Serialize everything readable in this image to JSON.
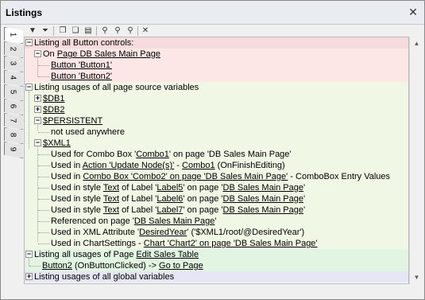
{
  "window": {
    "title": "Listings",
    "close_glyph": "✕"
  },
  "tabs": [
    "1",
    "2",
    "3",
    "4",
    "5",
    "6",
    "7",
    "8",
    "9"
  ],
  "toolbar": {
    "buttons": [
      "dropdown-icon",
      "collapse-all-icon",
      "expand-all-icon",
      "copy-icon",
      "copy-all-icon",
      "find-icon",
      "find-next-icon",
      "find-previous-icon",
      "clear-icon"
    ]
  },
  "tree": {
    "s1": {
      "header": "Listing all Button controls:",
      "page_prefix": "On ",
      "page_link": "Page DB Sales Main Page",
      "items": [
        "Button 'Button1'",
        "Button 'Button2'"
      ]
    },
    "s2": {
      "header": "Listing usages of all page source variables",
      "db1": "$DB1",
      "db2": "$DB2",
      "persistent": "$PERSISTENT",
      "not_used": "not used anywhere",
      "xml1": "$XML1",
      "x1": {
        "a": "Used for Combo Box '",
        "b": "Combo1",
        "c": "' on page '",
        "d": "DB Sales Main Page",
        "e": "'"
      },
      "x2": {
        "a": "Used in ",
        "b": "Action 'Update Node(s)'",
        "c": " - ",
        "d": "Combo1",
        "e": " (OnFinishEditing)"
      },
      "x3": {
        "a": "Used in ",
        "b": "Combo Box 'Combo2' on page 'DB Sales Main Page'",
        "c": " - ComboBox Entry Values"
      },
      "x4": {
        "a": "Used in style ",
        "b": "Text",
        "c": " of Label '",
        "d": "Label5",
        "e": "' on page '",
        "f": "DB Sales Main Page",
        "g": "'"
      },
      "x5": {
        "a": "Used in style ",
        "b": "Text",
        "c": " of Label '",
        "d": "Label6",
        "e": "' on page '",
        "f": "DB Sales Main Page",
        "g": "'"
      },
      "x6": {
        "a": "Used in style ",
        "b": "Text",
        "c": " of Label '",
        "d": "Label7",
        "e": "' on page '",
        "f": "DB Sales Main Page",
        "g": "'"
      },
      "x7": {
        "a": "Referenced on page '",
        "b": "DB Sales Main Page",
        "c": "'"
      },
      "x8": {
        "a": "Used in XML Attribute '",
        "b": "DesiredYear",
        "c": "' ('$XML1/root/@DesiredYear')"
      },
      "x9": {
        "a": "Used in ChartSettings - ",
        "b": "Chart 'Chart2' on page 'DB Sales Main Page'"
      }
    },
    "s3": {
      "prefix": "Listing all usages of Page ",
      "link": "Edit Sales Table",
      "item_a": "Button2",
      "item_b": " (OnButtonClicked) -> ",
      "item_c": "Go to Page"
    },
    "s4": {
      "header": "Listing usages of all global variables"
    }
  },
  "colors": {
    "pink": "#fde6e6",
    "green": "#f0f7e4",
    "mint": "#e2f4e2",
    "lavender": "#e6e6f6",
    "header_pink": "#f6dcdc"
  }
}
